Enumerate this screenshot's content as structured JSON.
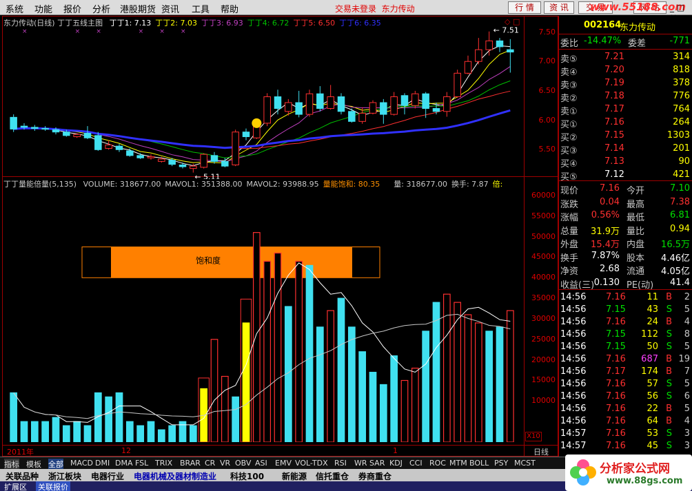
{
  "menu": {
    "items": [
      "系统",
      "功能",
      "报价",
      "分析",
      "港股期货",
      "资讯",
      "工具",
      "帮助"
    ],
    "status": "交易未登录",
    "stock_name": "东力传动",
    "buttons": [
      "行 情",
      "资 讯",
      "交 易",
      "网 站"
    ]
  },
  "watermark": "www.55188.com",
  "chart": {
    "title": "东力传动(日线)",
    "main_indicator": "丁丁五线主图",
    "ma_labels": [
      {
        "text": "丁丁1: 7.13",
        "color": "#ffffff"
      },
      {
        "text": "丁丁2: 7.03",
        "color": "#ffff00"
      },
      {
        "text": "丁丁3: 6.93",
        "color": "#c040c0"
      },
      {
        "text": "丁丁4: 6.72",
        "color": "#00c000"
      },
      {
        "text": "丁丁5: 6.50",
        "color": "#ff3030"
      },
      {
        "text": "丁丁6: 6.35",
        "color": "#3030ff"
      }
    ],
    "price_ticks": [
      "7.50",
      "7.00",
      "6.50",
      "6.00",
      "5.50"
    ],
    "high_label": "7.51",
    "low_label": "5.11",
    "vol_indicator": "丁丁量能倍量(5,135)",
    "vol_legend": [
      {
        "text": "VOLUME: 318677.00",
        "color": "#c8c8c8"
      },
      {
        "text": "MAVOL1: 351388.00",
        "color": "#c8c8c8"
      },
      {
        "text": "MAVOL2: 93988.95",
        "color": "#c8c8c8"
      },
      {
        "text": "量能饱和: 80.35",
        "color": "#ff9000"
      },
      {
        "text": "量: 318677.00",
        "color": "#c8c8c8"
      },
      {
        "text": "换手: 7.87",
        "color": "#c8c8c8"
      },
      {
        "text": "倍:",
        "color": "#ffff00"
      }
    ],
    "vol_ticks": [
      "60000",
      "55000",
      "50000",
      "45000",
      "40000",
      "35000",
      "30000",
      "25000",
      "20000",
      "15000",
      "10000"
    ],
    "vol_unit": "X10",
    "saturation_label": "饱和度",
    "date_labels": [
      "2011年",
      "12",
      "1"
    ],
    "period": "日线"
  },
  "chart_data": {
    "type": "candlestick",
    "ylim": [
      5.0,
      7.6
    ],
    "candles": [
      [
        6.05,
        5.85,
        6.1,
        5.8
      ],
      [
        5.9,
        5.88,
        5.95,
        5.84
      ],
      [
        5.88,
        5.86,
        5.92,
        5.82
      ],
      [
        5.86,
        5.85,
        5.9,
        5.82
      ],
      [
        5.84,
        5.8,
        5.88,
        5.76
      ],
      [
        5.8,
        5.74,
        5.84,
        5.72
      ],
      [
        5.72,
        5.76,
        5.78,
        5.7
      ],
      [
        5.78,
        5.7,
        5.9,
        5.68
      ],
      [
        5.74,
        5.5,
        5.8,
        5.48
      ],
      [
        5.52,
        5.58,
        5.66,
        5.5
      ],
      [
        5.56,
        5.5,
        5.6,
        5.46
      ],
      [
        5.48,
        5.4,
        5.52,
        5.38
      ],
      [
        5.4,
        5.36,
        5.44,
        5.34
      ],
      [
        5.36,
        5.38,
        5.42,
        5.33
      ],
      [
        5.3,
        5.34,
        5.38,
        5.28
      ],
      [
        5.32,
        5.25,
        5.36,
        5.22
      ],
      [
        5.24,
        5.21,
        5.28,
        5.18
      ],
      [
        5.18,
        5.22,
        5.26,
        5.11
      ],
      [
        5.2,
        5.42,
        5.44,
        5.18
      ],
      [
        5.4,
        5.3,
        5.46,
        5.26
      ],
      [
        5.3,
        5.22,
        5.36,
        5.2
      ],
      [
        5.24,
        5.8,
        5.84,
        5.22
      ],
      [
        5.8,
        5.72,
        5.86,
        5.66
      ],
      [
        5.7,
        5.9,
        5.94,
        5.68
      ],
      [
        5.95,
        6.4,
        6.46,
        5.9
      ],
      [
        6.4,
        6.2,
        6.52,
        6.1
      ],
      [
        6.15,
        6.3,
        6.36,
        6.08
      ],
      [
        6.3,
        6.1,
        6.5,
        6.05
      ],
      [
        6.1,
        6.45,
        6.52,
        6.06
      ],
      [
        6.45,
        6.2,
        6.58,
        6.15
      ],
      [
        6.2,
        6.4,
        6.6,
        6.18
      ],
      [
        6.4,
        6.15,
        6.46,
        6.1
      ],
      [
        6.15,
        5.98,
        6.2,
        5.96
      ],
      [
        5.98,
        6.12,
        6.22,
        5.94
      ],
      [
        6.12,
        6.3,
        6.34,
        6.1
      ],
      [
        6.3,
        6.1,
        6.36,
        5.94
      ],
      [
        6.1,
        6.4,
        6.48,
        6.08
      ],
      [
        6.42,
        6.25,
        6.46,
        6.1
      ],
      [
        6.25,
        6.45,
        6.5,
        6.2
      ],
      [
        6.45,
        6.2,
        6.48,
        6.04
      ],
      [
        6.2,
        6.15,
        6.3,
        6.1
      ],
      [
        6.15,
        6.4,
        6.48,
        6.06
      ],
      [
        6.4,
        6.8,
        6.86,
        6.38
      ],
      [
        6.8,
        7.0,
        7.1,
        6.78
      ],
      [
        7.0,
        7.2,
        7.4,
        6.95
      ],
      [
        7.2,
        7.35,
        7.51,
        7.1
      ],
      [
        7.35,
        7.25,
        7.4,
        7.16
      ],
      [
        7.2,
        7.16,
        7.38,
        6.81
      ]
    ],
    "volume": [
      12,
      5,
      5,
      5,
      6,
      4,
      5,
      4,
      12,
      11,
      12,
      5,
      4,
      5,
      3,
      4,
      5,
      4,
      13,
      25,
      16,
      11,
      29,
      51,
      44,
      46,
      33,
      44,
      43,
      28,
      32,
      35,
      28,
      22,
      17,
      14,
      21,
      15,
      18,
      27,
      34,
      36,
      34,
      31,
      29,
      27,
      28,
      32
    ],
    "vol_colors": [
      "c",
      "c",
      "c",
      "c",
      "c",
      "c",
      "c",
      "c",
      "c",
      "c",
      "c",
      "c",
      "c",
      "c",
      "c",
      "c",
      "c",
      "c",
      "y",
      "r",
      "r",
      "c",
      "y",
      "r",
      "r",
      "r",
      "c",
      "r",
      "c",
      "c",
      "r",
      "c",
      "c",
      "c",
      "c",
      "c",
      "c",
      "r",
      "r",
      "c",
      "c",
      "r",
      "r",
      "r",
      "r",
      "c",
      "c",
      "r"
    ]
  },
  "quote": {
    "code": "002164",
    "name": "东力传动",
    "weibi_label": "委比",
    "weibi": "-14.47%",
    "weicha_label": "委差",
    "weicha": "-771",
    "sell": [
      {
        "label": "卖⑤",
        "price": "7.21",
        "vol": "314"
      },
      {
        "label": "卖④",
        "price": "7.20",
        "vol": "818"
      },
      {
        "label": "卖③",
        "price": "7.19",
        "vol": "378"
      },
      {
        "label": "卖②",
        "price": "7.18",
        "vol": "776"
      },
      {
        "label": "卖①",
        "price": "7.17",
        "vol": "764"
      }
    ],
    "buy": [
      {
        "label": "买①",
        "price": "7.16",
        "vol": "264"
      },
      {
        "label": "买②",
        "price": "7.15",
        "vol": "1303"
      },
      {
        "label": "买③",
        "price": "7.14",
        "vol": "201"
      },
      {
        "label": "买④",
        "price": "7.13",
        "vol": "90"
      },
      {
        "label": "买⑤",
        "price": "7.12",
        "vol": "421"
      }
    ],
    "stats": [
      {
        "l1": "现价",
        "v1": "7.16",
        "l2": "今开",
        "v2": "7.10"
      },
      {
        "l1": "涨跌",
        "v1": "0.04",
        "l2": "最高",
        "v2": "7.38"
      },
      {
        "l1": "涨幅",
        "v1": "0.56%",
        "l2": "最低",
        "v2": "6.81"
      },
      {
        "l1": "总量",
        "v1": "31.9万",
        "l2": "量比",
        "v2": "0.94"
      },
      {
        "l1": "外盘",
        "v1": "15.4万",
        "l2": "内盘",
        "v2": "16.5万"
      },
      {
        "l1": "换手",
        "v1": "7.87%",
        "l2": "股本",
        "v2": "4.46亿"
      },
      {
        "l1": "净资",
        "v1": "2.68",
        "l2": "流通",
        "v2": "4.05亿"
      },
      {
        "l1": "收益(三)",
        "v1": "0.130",
        "l2": "PE(动)",
        "v2": "41.4"
      }
    ],
    "ticks": [
      {
        "t": "14:56",
        "p": "7.16",
        "v": "11",
        "s": "B",
        "n": "2"
      },
      {
        "t": "14:56",
        "p": "7.15",
        "v": "43",
        "s": "S",
        "n": "5"
      },
      {
        "t": "14:56",
        "p": "7.16",
        "v": "24",
        "s": "B",
        "n": "4"
      },
      {
        "t": "14:56",
        "p": "7.15",
        "v": "112",
        "s": "S",
        "n": "8"
      },
      {
        "t": "14:56",
        "p": "7.15",
        "v": "50",
        "s": "S",
        "n": "5"
      },
      {
        "t": "14:56",
        "p": "7.16",
        "v": "687",
        "s": "B",
        "n": "19"
      },
      {
        "t": "14:56",
        "p": "7.17",
        "v": "174",
        "s": "B",
        "n": "7"
      },
      {
        "t": "14:56",
        "p": "7.16",
        "v": "57",
        "s": "S",
        "n": "5"
      },
      {
        "t": "14:56",
        "p": "7.16",
        "v": "56",
        "s": "S",
        "n": "6"
      },
      {
        "t": "14:56",
        "p": "7.16",
        "v": "22",
        "s": "B",
        "n": "5"
      },
      {
        "t": "14:56",
        "p": "7.16",
        "v": "64",
        "s": "B",
        "n": "4"
      },
      {
        "t": "14:57",
        "p": "7.16",
        "v": "53",
        "s": "S",
        "n": "3"
      },
      {
        "t": "14:57",
        "p": "7.16",
        "v": "45",
        "s": "S",
        "n": "3"
      }
    ]
  },
  "indicator_tabs": [
    "指标",
    "模板",
    "全部",
    "MACD",
    "DMI",
    "DMA",
    "FSL",
    "TRIX",
    "BRAR",
    "CR",
    "VR",
    "OBV",
    "ASI",
    "EMV",
    "VOL-TDX",
    "RSI",
    "WR",
    "SAR",
    "KDJ",
    "CCI",
    "ROC",
    "MTM",
    "BOLL",
    "PSY",
    "MCST"
  ],
  "sector_tabs": [
    "关联品种",
    "浙江板块",
    "电器行业",
    "电器机械及器材制造业",
    "科技100",
    "新能源",
    "信托重仓",
    "券商重仓"
  ],
  "bottom_tabs": [
    "扩展区",
    "关联报价"
  ],
  "logo": {
    "name": "分析家公式网",
    "url": "www.88gs.com"
  }
}
